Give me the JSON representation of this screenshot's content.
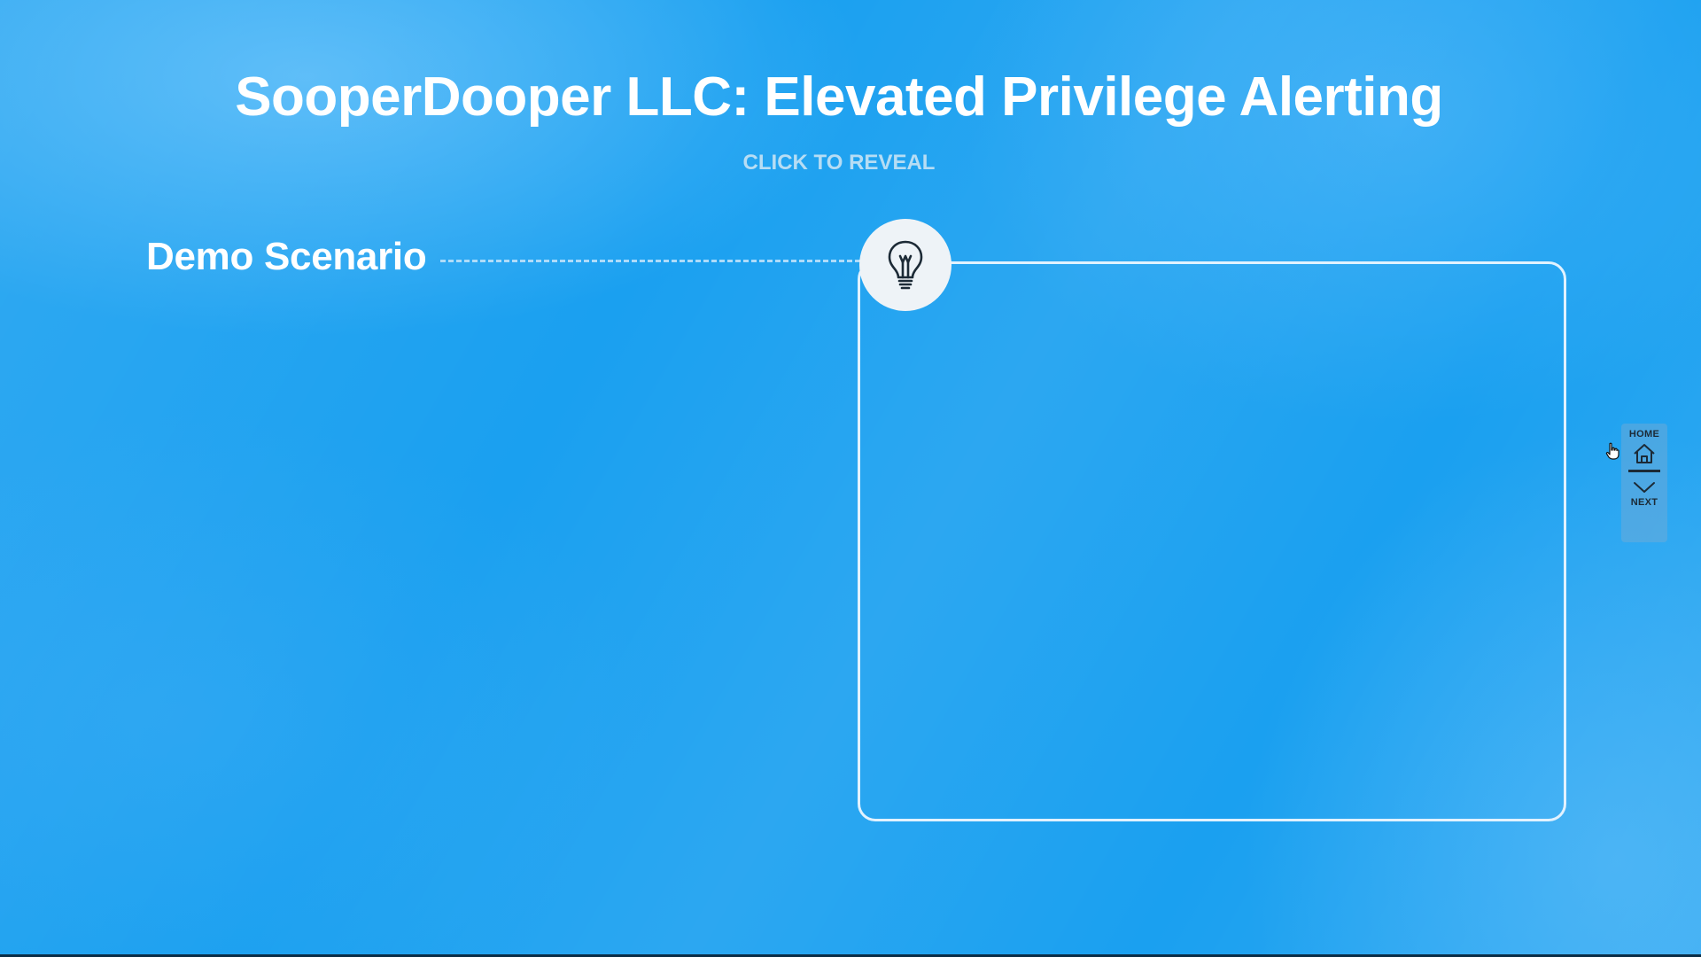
{
  "slide": {
    "title": "SooperDooper LLC: Elevated Privilege Alerting",
    "reveal_hint": "CLICK TO REVEAL",
    "scenario_label": "Demo Scenario"
  },
  "reveal": {
    "icon": "lightbulb-icon"
  },
  "nav": {
    "home_label": "HOME",
    "home_icon": "home-icon",
    "next_label": "NEXT",
    "next_icon": "chevron-down-icon"
  },
  "colors": {
    "background": "#1aa0f0",
    "text": "#ffffff",
    "badge": "#eef3f7",
    "nav_ink": "#1c2a36"
  }
}
